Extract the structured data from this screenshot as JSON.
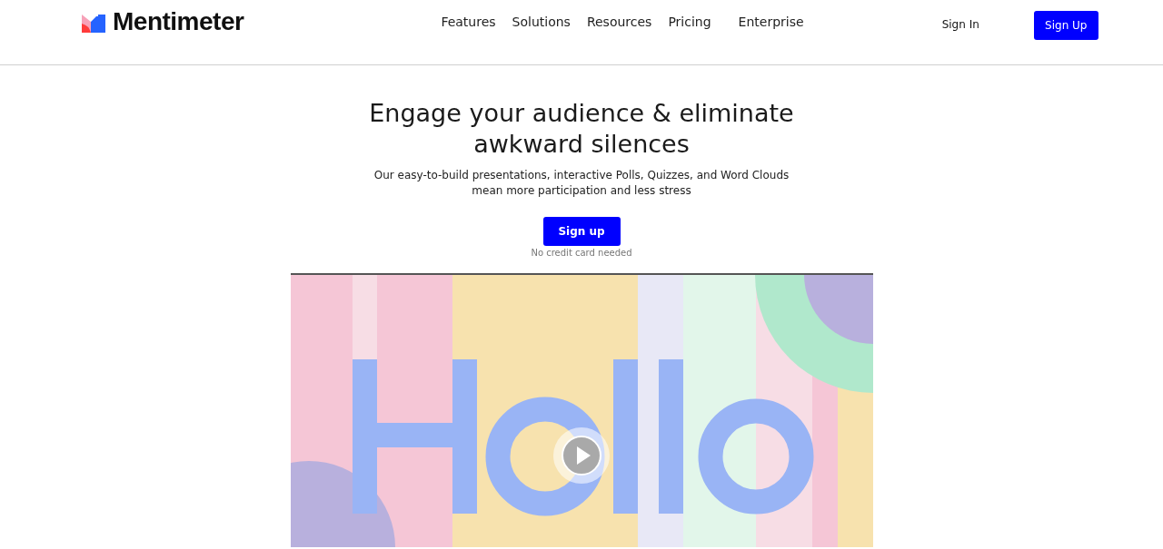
{
  "header": {
    "logo": "Mentimeter",
    "nav": [
      "Features",
      "Solutions",
      "Resources",
      "Pricing",
      "Enterprise"
    ],
    "sign_in": "Sign In",
    "sign_up": "Sign Up"
  },
  "hero": {
    "title": "Engage your audience & eliminate awkward silences",
    "subtitle": "Our easy-to-build presentations, interactive Polls, Quizzes, and Word Clouds mean more participation and less stress",
    "cta": "Sign up",
    "note": "No credit card needed"
  }
}
